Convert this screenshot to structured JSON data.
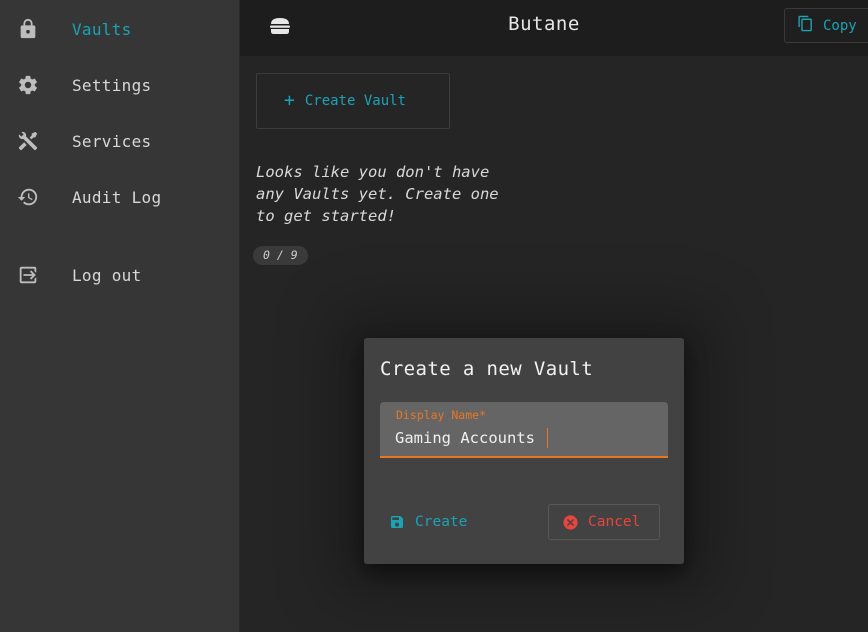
{
  "sidebar": {
    "items": [
      {
        "label": "Vaults",
        "icon": "lock-icon",
        "active": true
      },
      {
        "label": "Settings",
        "icon": "gear-icon",
        "active": false
      },
      {
        "label": "Services",
        "icon": "tools-icon",
        "active": false
      },
      {
        "label": "Audit Log",
        "icon": "history-icon",
        "active": false
      },
      {
        "label": "Log out",
        "icon": "logout-icon",
        "active": false
      }
    ]
  },
  "header": {
    "title": "Butane",
    "copy_label": "Copy",
    "menu_icon": "hamburger-icon"
  },
  "main": {
    "create_vault_label": "Create Vault",
    "empty_message": "Looks like you don't have any Vaults yet. Create one to get started!",
    "vault_count": "0 / 9"
  },
  "dialog": {
    "title": "Create a new Vault",
    "field_label": "Display Name*",
    "field_value": "Gaming Accounts",
    "create_label": "Create",
    "cancel_label": "Cancel"
  },
  "colors": {
    "accent": "#1aa3b5",
    "focus": "#e87722",
    "danger": "#e8453c"
  }
}
